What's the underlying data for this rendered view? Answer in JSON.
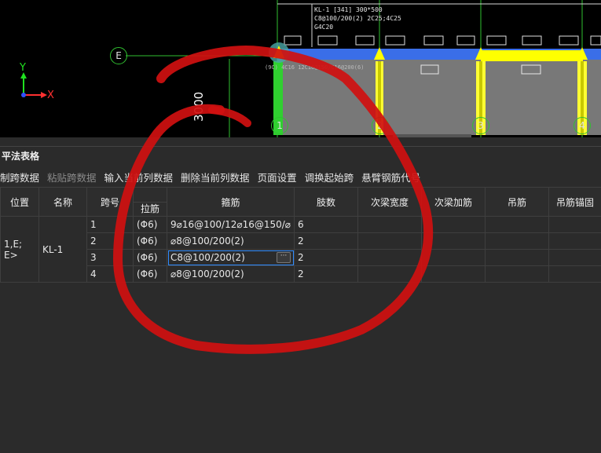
{
  "viewport": {
    "beam_label_lines": [
      "KL-1 [341] 300*500",
      "C8@100/200(2) 2C25;4C25",
      "G4C20"
    ],
    "axis_x": "X",
    "axis_y": "Y",
    "grid_e": "E",
    "grid_cols": [
      "1",
      "2",
      "3",
      "4"
    ],
    "dimension": "3000",
    "support_text": "(9C) 4C16 12C16@150/C16@200(6)"
  },
  "panel": {
    "title": "平法表格"
  },
  "toolbar": {
    "items": [
      {
        "label": "制跨数据",
        "enabled": true
      },
      {
        "label": "粘贴跨数据",
        "enabled": false
      },
      {
        "label": "输入当前列数据",
        "enabled": true
      },
      {
        "label": "删除当前列数据",
        "enabled": true
      },
      {
        "label": "页面设置",
        "enabled": true
      },
      {
        "label": "调换起始跨",
        "enabled": true
      },
      {
        "label": "悬臂钢筋代号",
        "enabled": true
      }
    ]
  },
  "table": {
    "headers": {
      "position": "位置",
      "name": "名称",
      "span": "跨号",
      "tie_bar": "拉筋",
      "stirrup": "箍筋",
      "legs": "肢数",
      "secondary_width": "次梁宽度",
      "secondary_bar": "次梁加筋",
      "hanger": "吊筋",
      "hanger_anchor": "吊筋锚固"
    },
    "position_text": "1,E;\nE>",
    "name_text": "KL-1",
    "rows": [
      {
        "span": "1",
        "tie": "(Φ6)",
        "stirrup": "9⌀16@100/12⌀16@150/⌀",
        "legs": "6"
      },
      {
        "span": "2",
        "tie": "(Φ6)",
        "stirrup": "⌀8@100/200(2)",
        "legs": "2"
      },
      {
        "span": "3",
        "tie": "(Φ6)",
        "stirrup": "C8@100/200(2)",
        "legs": "2"
      },
      {
        "span": "4",
        "tie": "(Φ6)",
        "stirrup": "⌀8@100/200(2)",
        "legs": "2"
      }
    ],
    "ellipsis": "···"
  },
  "colors": {
    "annotation_red": "#d01010",
    "beam_blue": "#3a6ee8",
    "column_yellow": "#ffff00",
    "edit_outline": "#2f8bff"
  }
}
